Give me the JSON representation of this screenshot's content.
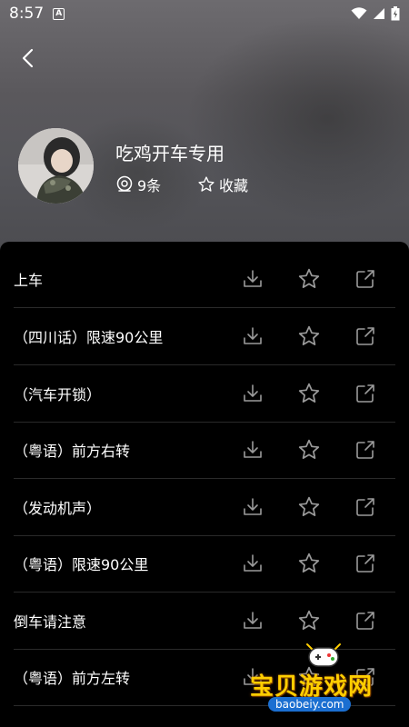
{
  "status_bar": {
    "time": "8:57",
    "notification_letter": "A"
  },
  "album": {
    "title": "吃鸡开车专用",
    "count": "9条",
    "favorite_label": "收藏"
  },
  "tracks": [
    {
      "name": "上车"
    },
    {
      "name": "（四川话）限速90公里"
    },
    {
      "name": "（汽车开锁）"
    },
    {
      "name": "（粤语）前方右转"
    },
    {
      "name": "（发动机声）"
    },
    {
      "name": "（粤语）限速90公里"
    },
    {
      "name": "倒车请注意"
    },
    {
      "name": "（粤语）前方左转"
    }
  ],
  "watermark": {
    "title": "宝贝游戏网",
    "url": "baobeiy.com"
  },
  "colors": {
    "background": "#000000",
    "text": "#ffffff",
    "icon": "#9a9a9a",
    "divider": "#2a2a2a"
  }
}
